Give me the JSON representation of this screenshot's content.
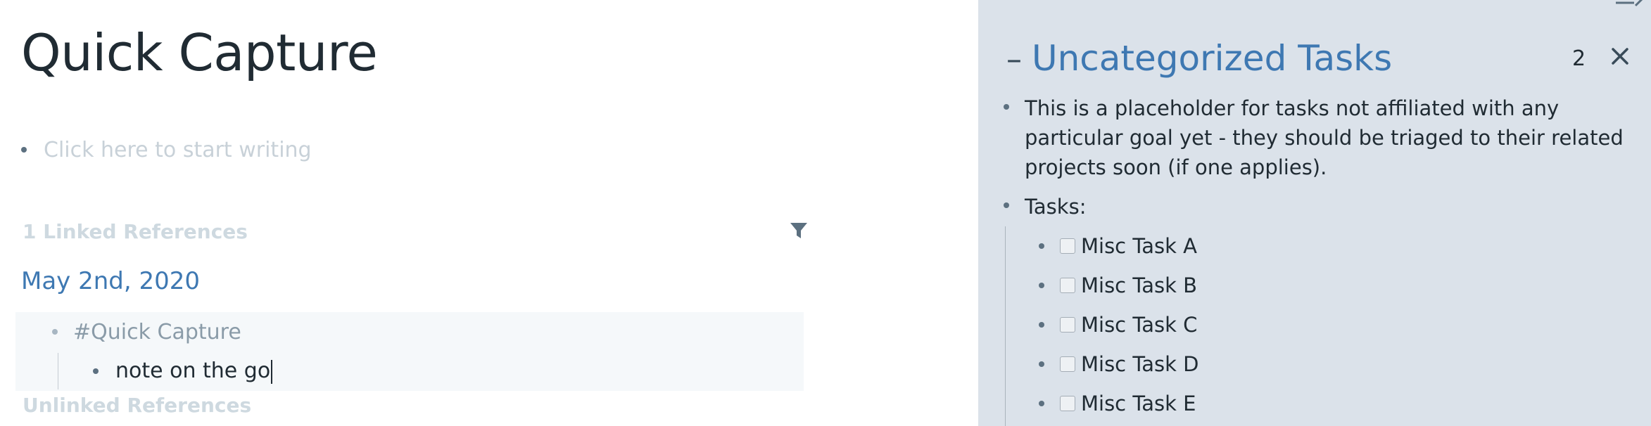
{
  "main": {
    "title": "Quick Capture",
    "placeholder": "Click here to start writing",
    "linked_references": {
      "heading": "1 Linked References",
      "filter_icon": "filter-icon",
      "date": "May 2nd, 2020",
      "tag": "#Quick Capture",
      "note": "note on the go"
    },
    "unlinked_references": {
      "heading": "Unlinked References"
    }
  },
  "sidebar": {
    "card": {
      "collapse_symbol": "–",
      "title": "Uncategorized Tasks",
      "count": "2",
      "close_icon": "close-icon",
      "description": "This is a placeholder for tasks not affiliated with any particular goal yet - they should be triaged to their related projects soon (if one applies).",
      "tasks_label": "Tasks:",
      "tasks": [
        {
          "label": "Misc Task A",
          "checked": false
        },
        {
          "label": "Misc Task B",
          "checked": false
        },
        {
          "label": "Misc Task C",
          "checked": false
        },
        {
          "label": "Misc Task D",
          "checked": false
        },
        {
          "label": "Misc Task E",
          "checked": false
        }
      ]
    }
  },
  "colors": {
    "link_blue": "#3e78b2",
    "sidebar_bg": "#dbe2ea",
    "muted_heading": "#ced9e0",
    "text": "#202b33"
  }
}
